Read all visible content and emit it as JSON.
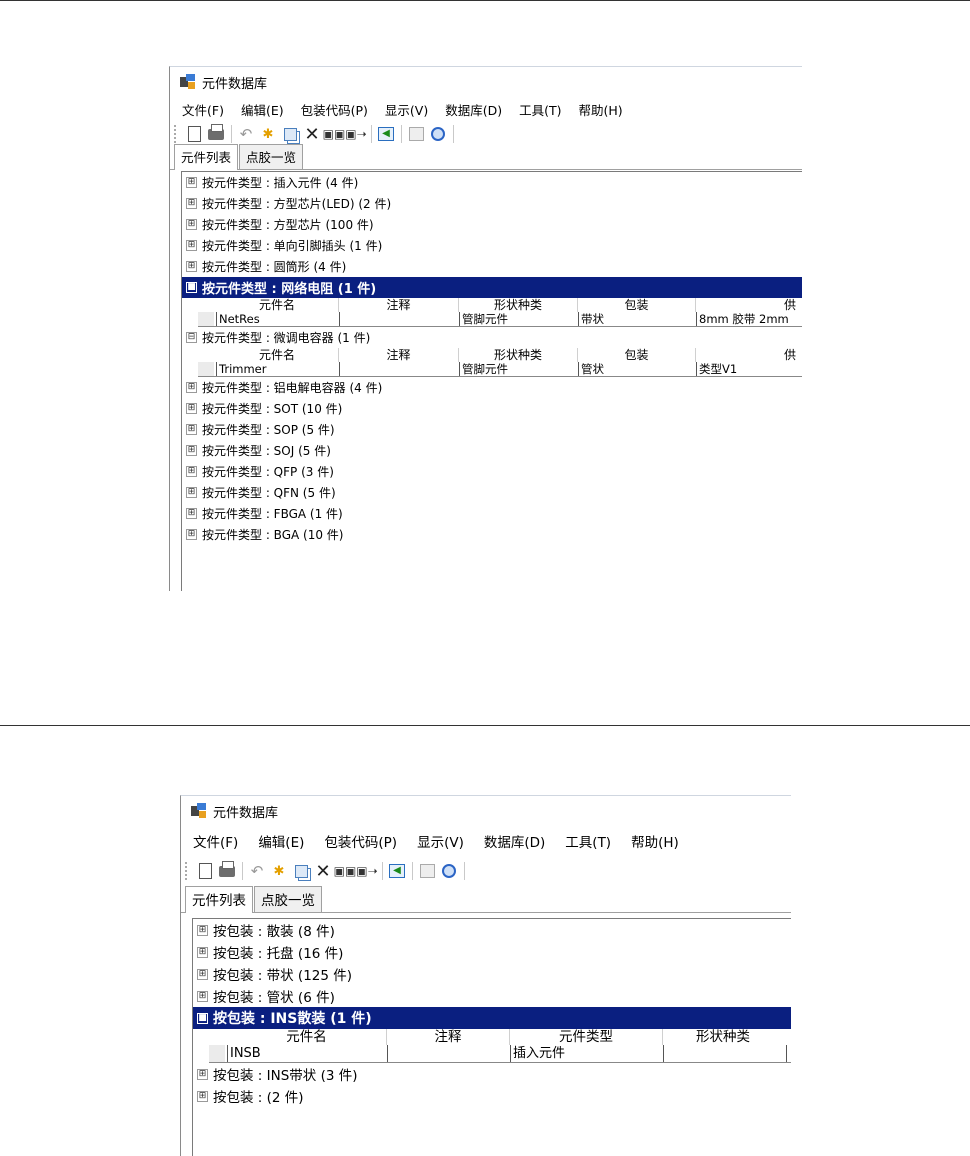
{
  "window1": {
    "title": "元件数据库",
    "menu": [
      "文件(F)",
      "编辑(E)",
      "包装代码(P)",
      "显示(V)",
      "数据库(D)",
      "工具(T)",
      "帮助(H)"
    ],
    "tabs": [
      "元件列表",
      "点胶一览"
    ],
    "groups_before": [
      "按元件类型 : 插入元件 (4 件)",
      "按元件类型 : 方型芯片(LED) (2 件)",
      "按元件类型 : 方型芯片 (100 件)",
      "按元件类型 : 单向引脚插头 (1 件)",
      "按元件类型 : 圆筒形 (4 件)"
    ],
    "selected_group": "按元件类型 : 网络电阻 (1 件)",
    "selected_table": {
      "headers": [
        "元件名",
        "注释",
        "形状种类",
        "包装",
        "供"
      ],
      "row": [
        "NetRes",
        "",
        "管脚元件",
        "带状",
        "8mm 胶带 2mm"
      ]
    },
    "second_group": "按元件类型 : 微调电容器 (1 件)",
    "second_table": {
      "headers": [
        "元件名",
        "注释",
        "形状种类",
        "包装",
        "供"
      ],
      "row": [
        "Trimmer",
        "",
        "管脚元件",
        "管状",
        "类型V1"
      ]
    },
    "groups_after": [
      "按元件类型 : 铝电解电容器 (4 件)",
      "按元件类型 : SOT (10 件)",
      "按元件类型 : SOP (5 件)",
      "按元件类型 : SOJ (5 件)",
      "按元件类型 : QFP (3 件)",
      "按元件类型 : QFN (5 件)",
      "按元件类型 : FBGA (1 件)",
      "按元件类型 : BGA (10 件)"
    ]
  },
  "window2": {
    "title": "元件数据库",
    "menu": [
      "文件(F)",
      "编辑(E)",
      "包装代码(P)",
      "显示(V)",
      "数据库(D)",
      "工具(T)",
      "帮助(H)"
    ],
    "tabs": [
      "元件列表",
      "点胶一览"
    ],
    "groups_before": [
      "按包装 : 散装 (8 件)",
      "按包装 : 托盘 (16 件)",
      "按包装 : 带状 (125 件)",
      "按包装 : 管状 (6 件)"
    ],
    "selected_group": "按包装 : INS散装 (1 件)",
    "selected_table": {
      "headers": [
        "元件名",
        "注释",
        "元件类型",
        "形状种类"
      ],
      "row": [
        "INSB",
        "",
        "插入元件",
        ""
      ]
    },
    "groups_after": [
      "按包装 : INS带状 (3 件)",
      "按包装 : (2 件)"
    ]
  },
  "icons": {
    "collapsed": "⊞",
    "expanded": "⊟",
    "selected": "■"
  }
}
